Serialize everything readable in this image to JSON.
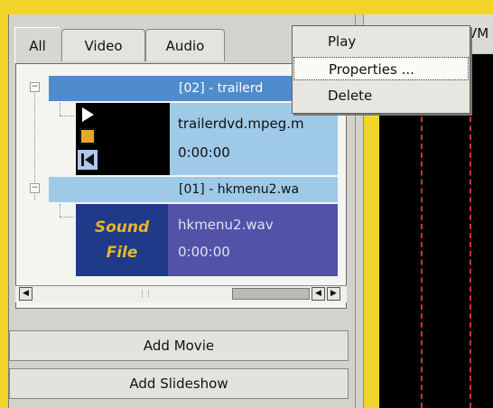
{
  "tabs": [
    {
      "label": "All",
      "active": true
    },
    {
      "label": "Video",
      "active": false
    },
    {
      "label": "Audio",
      "active": false
    }
  ],
  "tree": {
    "groups": [
      {
        "header": "[02] - trailerd",
        "item": {
          "name": "trailerdvd.mpeg.m",
          "duration": "0:00:00"
        }
      },
      {
        "header": "[01] - hkmenu2.wa",
        "item": {
          "name": "hkmenu2.wav",
          "duration": "0:00:00",
          "thumb_line1": "Sound",
          "thumb_line2": "File"
        }
      }
    ]
  },
  "buttons": {
    "add_movie": "Add Movie",
    "add_slideshow": "Add Slideshow"
  },
  "right_panel": {
    "title_fragment": "VM"
  },
  "context_menu": {
    "items": [
      "Play",
      "Properties ...",
      "Delete"
    ],
    "highlighted": "Properties ..."
  },
  "colors": {
    "selection": "#4f8ccc",
    "item_row": "#9ecae8",
    "audio_row": "#5252a8",
    "frame_yellow": "#f2d52b"
  }
}
